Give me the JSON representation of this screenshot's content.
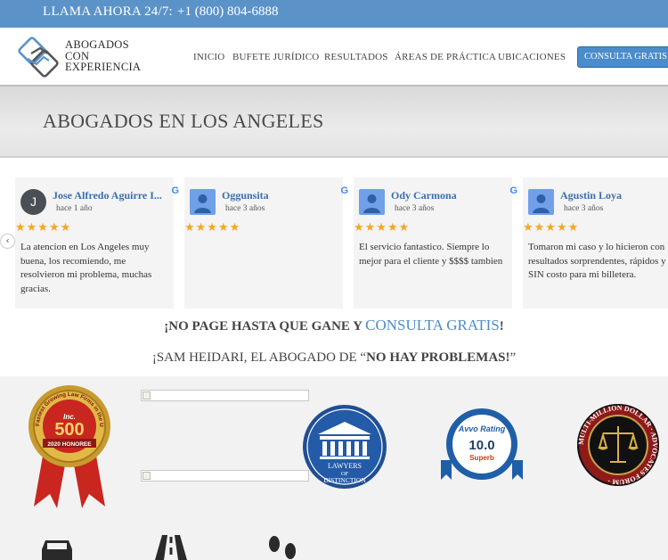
{
  "topbar": {
    "call_label": "LLAMA AHORA 24/7:",
    "phone": "+1 (800) 804-6888"
  },
  "logo": {
    "line1": "ABOGADOS",
    "line2": "CON",
    "line3": "EXPERIENCIA"
  },
  "nav": [
    "INICIO",
    "BUFETE JURÍDICO",
    "RESULTADOS",
    "ÁREAS DE PRÁCTICA",
    "UBICACIONES"
  ],
  "cta_label": "CONSULTA GRATIS",
  "page_title": "ABOGADOS EN LOS ANGELES",
  "reviews": [
    {
      "name": "Jose Alfredo Aguirre I...",
      "ago": "hace 1 año",
      "stars": "★★★★★",
      "text": "La atencion en Los Angeles muy buena, los recomiendo, me resolvieron mi problema, muchas gracias.",
      "initial": "J",
      "g": "G"
    },
    {
      "name": "Oggunsita",
      "ago": "hace 3 años",
      "stars": "★★★★★",
      "text": "",
      "g": "G"
    },
    {
      "name": "Ody Carmona",
      "ago": "hace 3 años",
      "stars": "★★★★★",
      "text": "El servicio fantastico. Siempre lo mejor para el cliente y $$$$ tambien",
      "g": "G"
    },
    {
      "name": "Agustin Loya",
      "ago": "hace 3 años",
      "stars": "★★★★★",
      "text": "Tomaron mi caso y lo hicieron con resultados sorprendentes, rápidos y SIN costo para mi billetera.",
      "g": "G"
    }
  ],
  "promo1": {
    "part1": "¡NO PAGE HASTA QUE GANE Y ",
    "accent": "CONSULTA GRATIS",
    "part2": "!"
  },
  "promo2": {
    "part1": "¡SAM HEIDARI, EL ABOGADO DE “",
    "bold": "NO HAY PROBLEMAS!",
    "part2": "”"
  },
  "badges": {
    "inc500": {
      "ring": "Fastest Growing Law Firms in the U.S.",
      "brand": "Inc.",
      "number": "500",
      "year": "2020 HONOREE"
    },
    "lawyers": {
      "line1": "LAWYERS",
      "line2": "OF",
      "line3": "DISTINCTION"
    },
    "avvo": {
      "title": "Avvo Rating",
      "score": "10.0",
      "label": "Superb"
    },
    "mmdaf": {
      "ring": "MULTI-MILLION DOLLAR · ADVOCATES FORUM ·"
    }
  },
  "colors": {
    "topbar": "#5b93c9",
    "accent": "#4a8ccc",
    "star": "#f5a623",
    "name": "#3a6fb0"
  }
}
